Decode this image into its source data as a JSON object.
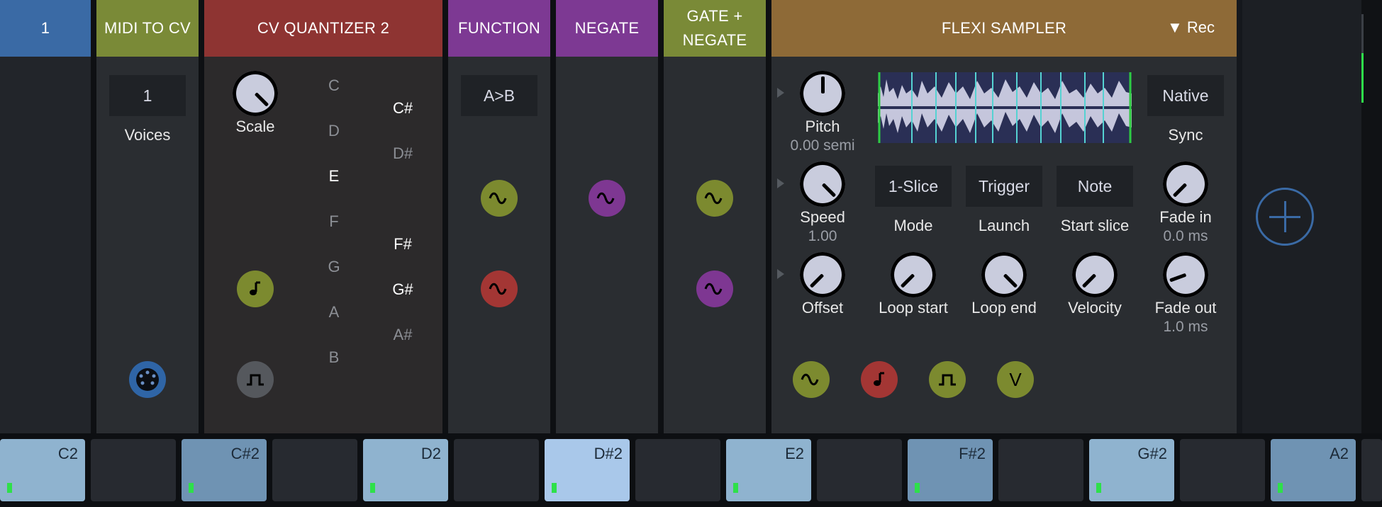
{
  "modules": {
    "track": {
      "label": "1"
    },
    "midi_to_cv": {
      "title": "MIDI TO CV",
      "voices_value": "1",
      "voices_label": "Voices"
    },
    "quantizer": {
      "title": "CV QUANTIZER 2",
      "scale_label": "Scale",
      "naturals": [
        "C",
        "D",
        "E",
        "F",
        "G",
        "A",
        "B"
      ],
      "sharps": [
        "C#",
        "D#",
        "F#",
        "G#",
        "A#"
      ]
    },
    "function": {
      "title": "FUNCTION",
      "mode": "A>B"
    },
    "negate": {
      "title": "NEGATE"
    },
    "gate_negate": {
      "title_line1": "GATE +",
      "title_line2": "NEGATE"
    },
    "flexi": {
      "title": "FLEXI SAMPLER",
      "rec": "▼ Rec",
      "pitch_label": "Pitch",
      "pitch_value": "0.00 semi",
      "speed_label": "Speed",
      "speed_value": "1.00",
      "offset_label": "Offset",
      "loop_start_label": "Loop start",
      "loop_end_label": "Loop end",
      "velocity_label": "Velocity",
      "fade_in_label": "Fade in",
      "fade_in_value": "0.0 ms",
      "fade_out_label": "Fade out",
      "fade_out_value": "1.0 ms",
      "sync_value": "Native",
      "sync_label": "Sync",
      "mode_value": "1-Slice",
      "mode_label": "Mode",
      "launch_value": "Trigger",
      "launch_label": "Launch",
      "start_slice_value": "Note",
      "start_slice_label": "Start slice",
      "velocity_port": "V"
    }
  },
  "keyboard": {
    "keys": [
      "C2",
      "C#2",
      "D2",
      "D#2",
      "E2",
      "F#2",
      "G#2",
      "A2"
    ]
  },
  "colors": {
    "green": "#7c8a2f",
    "red": "#a33634",
    "purple": "#7e3792",
    "blue": "#3a6aa5",
    "amber": "#8e6a37"
  }
}
